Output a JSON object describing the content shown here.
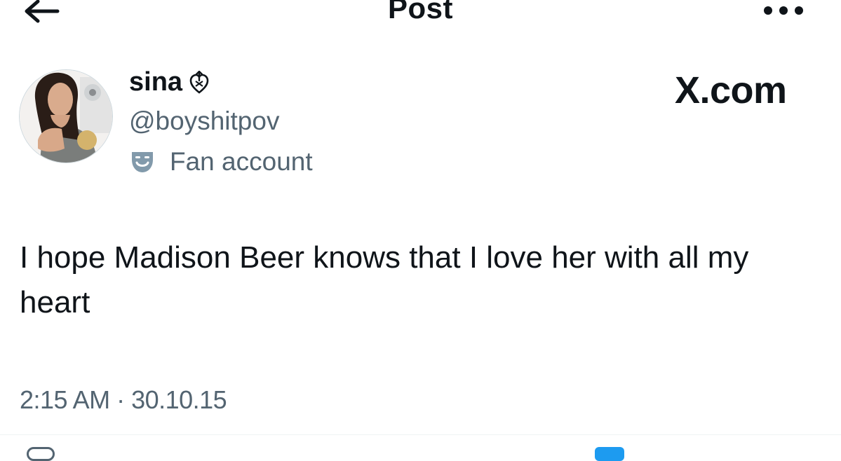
{
  "header": {
    "title": "Post",
    "back_icon": "arrow-left-icon",
    "more_icon": "more-horizontal-icon"
  },
  "author": {
    "display_name": "sina",
    "name_emoji": "heart-with-arrow-icon",
    "handle": "@boyshitpov",
    "label": "Fan account",
    "label_icon": "theater-masks-icon"
  },
  "watermark": "X.com",
  "tweet": {
    "text": "I hope Madison Beer knows that I love her with all my heart",
    "timestamp": "2:15 AM · 30.10.15"
  },
  "colors": {
    "text_primary": "#0f1419",
    "text_secondary": "#536471",
    "accent": "#1d9bf0"
  }
}
